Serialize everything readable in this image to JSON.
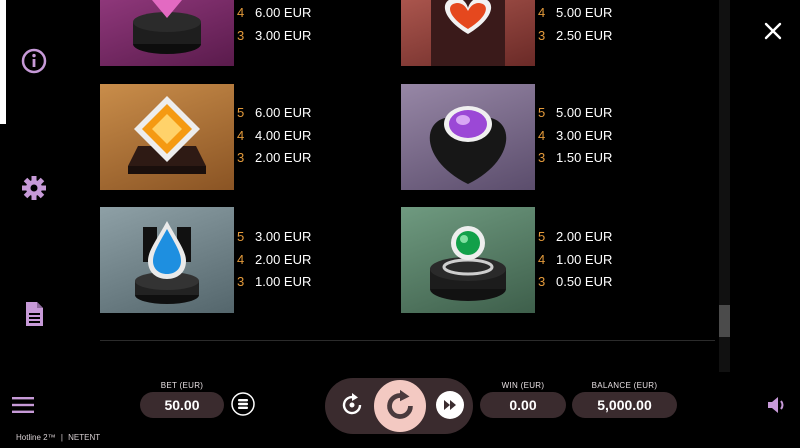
{
  "paytable": {
    "symbols": [
      {
        "icon": "pink-diamond-icon",
        "color": "#c0489f",
        "pays": [
          {
            "n": "4",
            "v": "6.00 EUR"
          },
          {
            "n": "3",
            "v": "3.00 EUR"
          }
        ]
      },
      {
        "icon": "ruby-heart-necklace-icon",
        "color": "#c2523e",
        "pays": [
          {
            "n": "4",
            "v": "5.00 EUR"
          },
          {
            "n": "3",
            "v": "2.50 EUR"
          }
        ]
      },
      {
        "icon": "orange-gem-icon",
        "color": "#c57f2a",
        "pays": [
          {
            "n": "5",
            "v": "6.00 EUR"
          },
          {
            "n": "4",
            "v": "4.00 EUR"
          },
          {
            "n": "3",
            "v": "2.00 EUR"
          }
        ]
      },
      {
        "icon": "amethyst-heart-icon",
        "color": "#8a4fb8",
        "pays": [
          {
            "n": "5",
            "v": "5.00 EUR"
          },
          {
            "n": "4",
            "v": "3.00 EUR"
          },
          {
            "n": "3",
            "v": "1.50 EUR"
          }
        ]
      },
      {
        "icon": "sapphire-pendant-icon",
        "color": "#1c8fd8",
        "pays": [
          {
            "n": "5",
            "v": "3.00 EUR"
          },
          {
            "n": "4",
            "v": "2.00 EUR"
          },
          {
            "n": "3",
            "v": "1.00 EUR"
          }
        ]
      },
      {
        "icon": "emerald-ring-icon",
        "color": "#1a9a4c",
        "pays": [
          {
            "n": "5",
            "v": "2.00 EUR"
          },
          {
            "n": "4",
            "v": "1.00 EUR"
          },
          {
            "n": "3",
            "v": "0.50 EUR"
          }
        ]
      }
    ]
  },
  "bet": {
    "label": "BET (EUR)",
    "value": "50.00"
  },
  "win": {
    "label": "WIN (EUR)",
    "value": "0.00"
  },
  "balance": {
    "label": "BALANCE (EUR)",
    "value": "5,000.00"
  },
  "footer": {
    "game": "Hotline 2™",
    "separator": "|",
    "brand": "NETENT"
  },
  "colors": {
    "accent": "#c79ad8",
    "pill_bg": "#3a2b2e",
    "spin_button": "#f3c9c2",
    "pay_count": "#e39a3b"
  }
}
